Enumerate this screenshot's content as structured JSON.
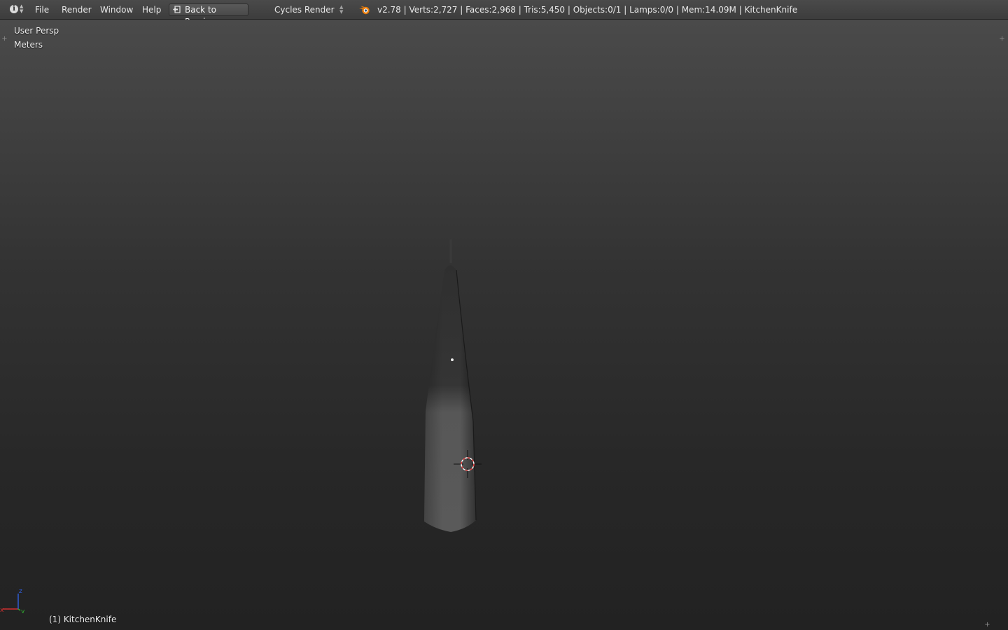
{
  "menubar": {
    "editor_type_icon": "info-icon",
    "menus": [
      {
        "label": "File"
      },
      {
        "label": "Render"
      },
      {
        "label": "Window"
      },
      {
        "label": "Help"
      }
    ],
    "back_button": {
      "label": "Back to Previous",
      "icon": "back-arrow-icon"
    },
    "render_engine": {
      "selected": "Cycles Render"
    },
    "stats": "v2.78 | Verts:2,727 | Faces:2,968 | Tris:5,450 | Objects:0/1 | Lamps:0/0 | Mem:14.09M | KitchenKnife"
  },
  "viewport": {
    "view_name": "User Persp",
    "units": "Meters",
    "object_info": "(1) KitchenKnife",
    "axes": {
      "x_label": "x",
      "y_label": "y",
      "z_label": "z",
      "x_color": "#d03030",
      "y_color": "#30b030",
      "z_color": "#3060e0"
    }
  },
  "colors": {
    "header": "#404040",
    "viewport_top": "#4a4a4a",
    "viewport_bottom": "#222222",
    "cursor_red": "#e03030"
  }
}
